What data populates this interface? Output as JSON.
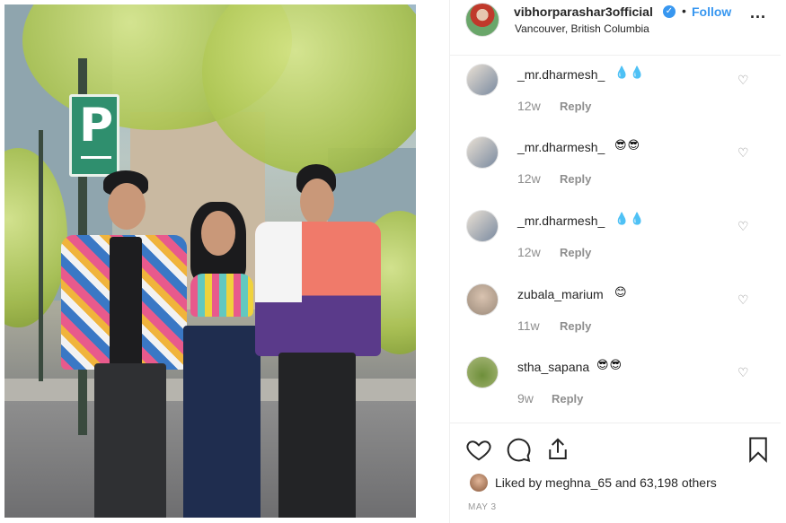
{
  "header": {
    "username": "vibhorparashar3official",
    "separator": "•",
    "follow_label": "Follow",
    "location": "Vancouver, British Columbia",
    "more_label": "..."
  },
  "comments": [
    {
      "username": "_mr.dharmesh_",
      "emoji": "💧💧",
      "time": "12w",
      "reply": "Reply"
    },
    {
      "username": "_mr.dharmesh_",
      "emoji": "😎😎",
      "time": "12w",
      "reply": "Reply"
    },
    {
      "username": "_mr.dharmesh_",
      "emoji": "💧💧",
      "time": "12w",
      "reply": "Reply"
    },
    {
      "username": "zubala_marium",
      "emoji": "😊",
      "time": "11w",
      "reply": "Reply"
    },
    {
      "username": "stha_sapana",
      "emoji": "😎😎",
      "time": "9w",
      "reply": "Reply"
    }
  ],
  "photo": {
    "sign_text": "P"
  },
  "footer": {
    "liked_by": "Liked by meghna_65 and 63,198 others",
    "date": "MAY 3"
  },
  "icons": {
    "like": "heart-icon",
    "comment": "comment-icon",
    "share": "share-icon",
    "save": "bookmark-icon",
    "comment_like": "small-heart-icon",
    "verified": "verified-badge-icon"
  },
  "colors": {
    "follow": "#3897f0",
    "verified": "#3897f0",
    "muted": "#8e8e8e",
    "text": "#262626"
  }
}
